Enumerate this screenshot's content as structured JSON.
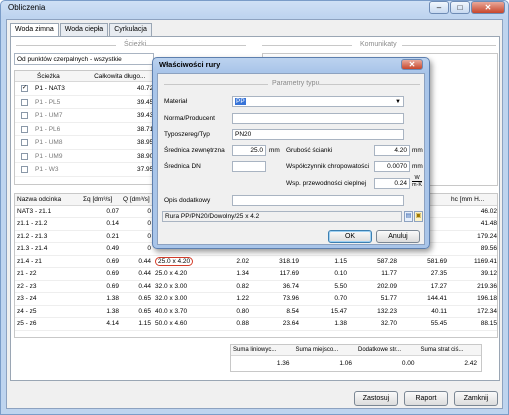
{
  "window": {
    "title": "Obliczenia",
    "title_buttons": [
      "–",
      "□",
      "✕"
    ]
  },
  "tabs": [
    {
      "label": "Woda zimna",
      "active": true
    },
    {
      "label": "Woda ciepła",
      "active": false
    },
    {
      "label": "Cyrkulacja",
      "active": false
    }
  ],
  "paths_section": {
    "header": "Ścieżki",
    "filter_value": "Od punktów czerpalnych - wszystkie",
    "columns": [
      "Ścieżka",
      "Całkowita długo..."
    ],
    "rows": [
      {
        "name": "P1 - NAT3",
        "value": "40.72",
        "checked": true
      },
      {
        "name": "P1 - PL5",
        "value": "39.45",
        "checked": false
      },
      {
        "name": "P1 - UM7",
        "value": "39.43",
        "checked": false
      },
      {
        "name": "P1 - PL6",
        "value": "38.71",
        "checked": false
      },
      {
        "name": "P1 - UM8",
        "value": "38.95",
        "checked": false
      },
      {
        "name": "P1 - UM9",
        "value": "38.90",
        "checked": false
      },
      {
        "name": "P1 - W3",
        "value": "37.95",
        "checked": false
      }
    ]
  },
  "comments_section": {
    "header": "Komunikaty"
  },
  "segments": {
    "columns": [
      "Nazwa odcinka",
      "Σq [dm³/s]",
      "Q [dm³/s]",
      "",
      "",
      "",
      "",
      "",
      "",
      "hc [mm H..."
    ],
    "rows": [
      [
        "NAT3 - z1.1",
        "0.07",
        "0",
        "",
        "",
        "",
        "",
        "",
        "",
        "46.02"
      ],
      [
        "z1.1 - z1.2",
        "0.14",
        "0",
        "",
        "",
        "",
        "",
        "",
        "",
        "41.48"
      ],
      [
        "z1.2 - z1.3",
        "0.21",
        "0",
        "",
        "",
        "",
        "",
        "",
        "",
        "179.24"
      ],
      [
        "z1.3 - z1.4",
        "0.49",
        "0",
        "",
        "",
        "",
        "",
        "",
        "",
        "89.56"
      ],
      [
        "z1.4 - z1",
        "0.69",
        "0.44",
        "25.0 x 4.20",
        "2.02",
        "318.19",
        "1.15",
        "587.28",
        "581.69",
        "1169.41"
      ],
      [
        "z1 - z2",
        "0.69",
        "0.44",
        "25.0 x 4.20",
        "1.34",
        "117.69",
        "0.10",
        "11.77",
        "27.35",
        "39.12"
      ],
      [
        "z2 - z3",
        "0.69",
        "0.44",
        "32.0 x 3.00",
        "0.82",
        "36.74",
        "5.50",
        "202.09",
        "17.27",
        "219.36"
      ],
      [
        "z3 - z4",
        "1.38",
        "0.65",
        "32.0 x 3.00",
        "1.22",
        "73.96",
        "0.70",
        "51.77",
        "144.41",
        "196.18"
      ],
      [
        "z4 - z5",
        "1.38",
        "0.65",
        "40.0 x 3.70",
        "0.80",
        "8.54",
        "15.47",
        "132.23",
        "40.11",
        "172.34"
      ],
      [
        "z5 - z6",
        "4.14",
        "1.15",
        "50.0 x 4.60",
        "0.88",
        "23.64",
        "1.38",
        "32.70",
        "55.45",
        "88.15"
      ]
    ],
    "highlighted_dim": "25.0 x 4.20"
  },
  "summary": {
    "columns": [
      "Suma liniowyc...",
      "Suma miejsco...",
      "Dodatkowe str...",
      "Suma strat ciś..."
    ],
    "values": [
      "1.36",
      "1.06",
      "0.00",
      "2.42"
    ]
  },
  "bottom_buttons": {
    "calc": "Zastosuj",
    "report": "Raport",
    "close": "Zamknij"
  },
  "dialog": {
    "title": "Właściwości rury",
    "group_label": "Parametry typu",
    "material_label": "Materiał",
    "material_value": "PP",
    "producer_label": "Norma/Producent",
    "producer_value": "",
    "type_label": "Typoszereg/Typ",
    "type_value": "PN20",
    "outer_diam_label": "Średnica zewnętrzna",
    "outer_diam_value": "25.0",
    "outer_diam_unit": "mm",
    "wall_label": "Grubość ścianki",
    "wall_value": "4.20",
    "wall_unit": "mm",
    "dn_label": "Średnica DN",
    "dn_value": "",
    "roughness_label": "Współczynnik chropowatości",
    "roughness_value": "0.0070",
    "roughness_unit": "mm",
    "thermal_label": "Wsp. przewodności cieplnej",
    "thermal_value": "0.24",
    "thermal_unit_num": "W",
    "thermal_unit_den": "m·K",
    "extra_label": "Opis dodatkowy",
    "extra_value": "",
    "summary_text": "Rura PP/PN20/Dowolny/25 x 4.2",
    "ok": "OK",
    "cancel": "Anuluj"
  }
}
